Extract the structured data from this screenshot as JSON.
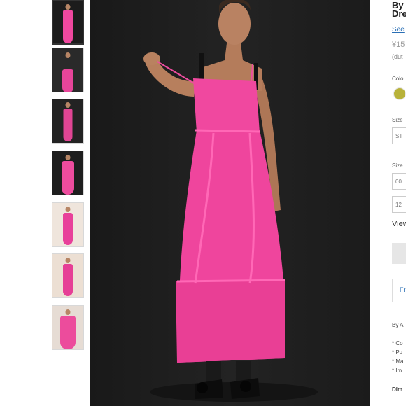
{
  "product": {
    "by_line": "By",
    "title_line": "Dre",
    "see_link": "See",
    "price": "¥15",
    "duty_note": "(dut",
    "color_label": "Colo",
    "size_label": "Size",
    "size_option_1": "ST",
    "size_label_2": "Size",
    "size_option_2": "00",
    "size_option_3": "12",
    "view_label": "View",
    "fr_button": "Fr",
    "by_a": "By A",
    "bullet_1": "* Co",
    "bullet_2": "* Pu",
    "bullet_3": "* Ma",
    "bullet_4": "* Im",
    "dim_label": "Dim"
  },
  "colors": {
    "dress": "#f0489f",
    "background": "#1e1e1e",
    "swatch": "#b8b23a",
    "link": "#2a6fb5"
  },
  "images": {
    "main_alt": "Pink midi slip dress on model",
    "thumbnail_count": 7
  }
}
